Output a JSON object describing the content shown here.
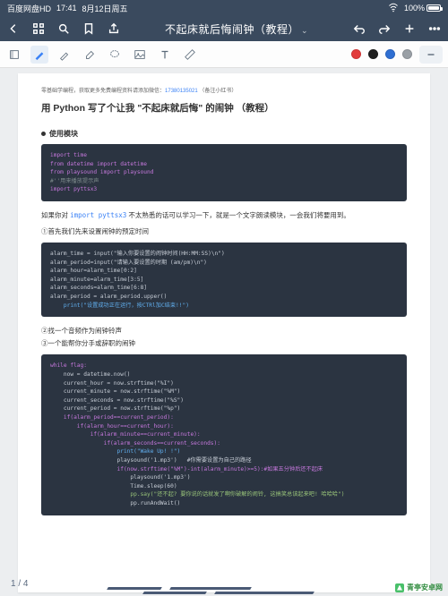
{
  "status": {
    "app": "百度网盘HD",
    "time": "17:41",
    "date": "8月12日周五",
    "wifi": "wifi",
    "battery_pct": "100%"
  },
  "titlebar": {
    "title": "不起床就后悔闹钟（教程）",
    "chevron": "⌄"
  },
  "tools": {
    "colors": {
      "red": "#e23b3b",
      "black": "#1f1f1f",
      "blue": "#2f6fd2",
      "gray": "#9aa0a6"
    }
  },
  "doc": {
    "meta_prefix": "零基础学编程，获取更多免费编程资料请添加微信：",
    "meta_phone": "17380135021",
    "meta_suffix": "（备注小红书）",
    "h1": "用 Python 写了个让我 \"不起床就后悔\" 的闹钟 （教程）",
    "sec1": "使用模块",
    "code1": {
      "l1": "import time",
      "l2": "from datetime import datetime",
      "l3": "from playsound import playsound",
      "l4": "#''用来播放提示声",
      "l5": "import pyttsx3"
    },
    "para1_a": "如果你对 ",
    "para1_code": "import pyttsx3",
    "para1_b": " 不太熟悉的话可以学习一下，就是一个文字朗读模块，一会我们将要用到。",
    "step1": "①首先我们先来设置闹钟的预定时间",
    "code2": {
      "l1": "alarm_time = input(\"输入你要设置的闹钟时间(HH:MM:SS)\\n\")",
      "l2": "alarm_period=input(\"请输入要设置的时期 (am/pm)\\n\")",
      "l3": "alarm_hour=alarm_time[0:2]",
      "l4": "alarm_minute=alarm_time[3:5]",
      "l5": "alarm_seconds=alarm_time[6:8]",
      "l6": "alarm_period = alarm_period.upper()",
      "l7": "    print(\"设置成功正在运行，按CTRl加C结束!!\")"
    },
    "step2": "②找一个音频作为闹钟铃声",
    "step3": "③一个能帮你分手或辞职的闹钟",
    "code3": {
      "l1": "while flag:",
      "l2": "    now = datetime.now()",
      "l3": "    current_hour = now.strftime(\"%I\")",
      "l4": "    current_minute = now.strftime(\"%M\")",
      "l5": "    current_seconds = now.strftime(\"%S\")",
      "l6": "    current_period = now.strftime(\"%p\")",
      "l7": "    if(alarm_period==current_period):",
      "l8": "        if(alarm_hour==current_hour):",
      "l9": "            if(alarm_minute==current_minute):",
      "l10": "                if(alarm_seconds==current_seconds):",
      "l11": "                    print(\"Wake Up! !\")",
      "l12": "                    playsound('1.mp3')   #你需要设置为自己的路径",
      "l13": "                    if(now.strftime(\"%M\")-int(alarm_minute)>=5):#如果五分钟后还不起床",
      "l14": "                        playsound('1.mp3')",
      "l15": "                        Time.sleep(60)",
      "l16": "                        pp.say(\"还不起? 要你说的话就发了啊你破解的闹铃, 这搞笑总该起来吧! 哈哈哈\")",
      "l17": "                        pp.runAndWait()"
    }
  },
  "footer": {
    "page": "1 / 4",
    "watermark": "青亭安卓网"
  }
}
